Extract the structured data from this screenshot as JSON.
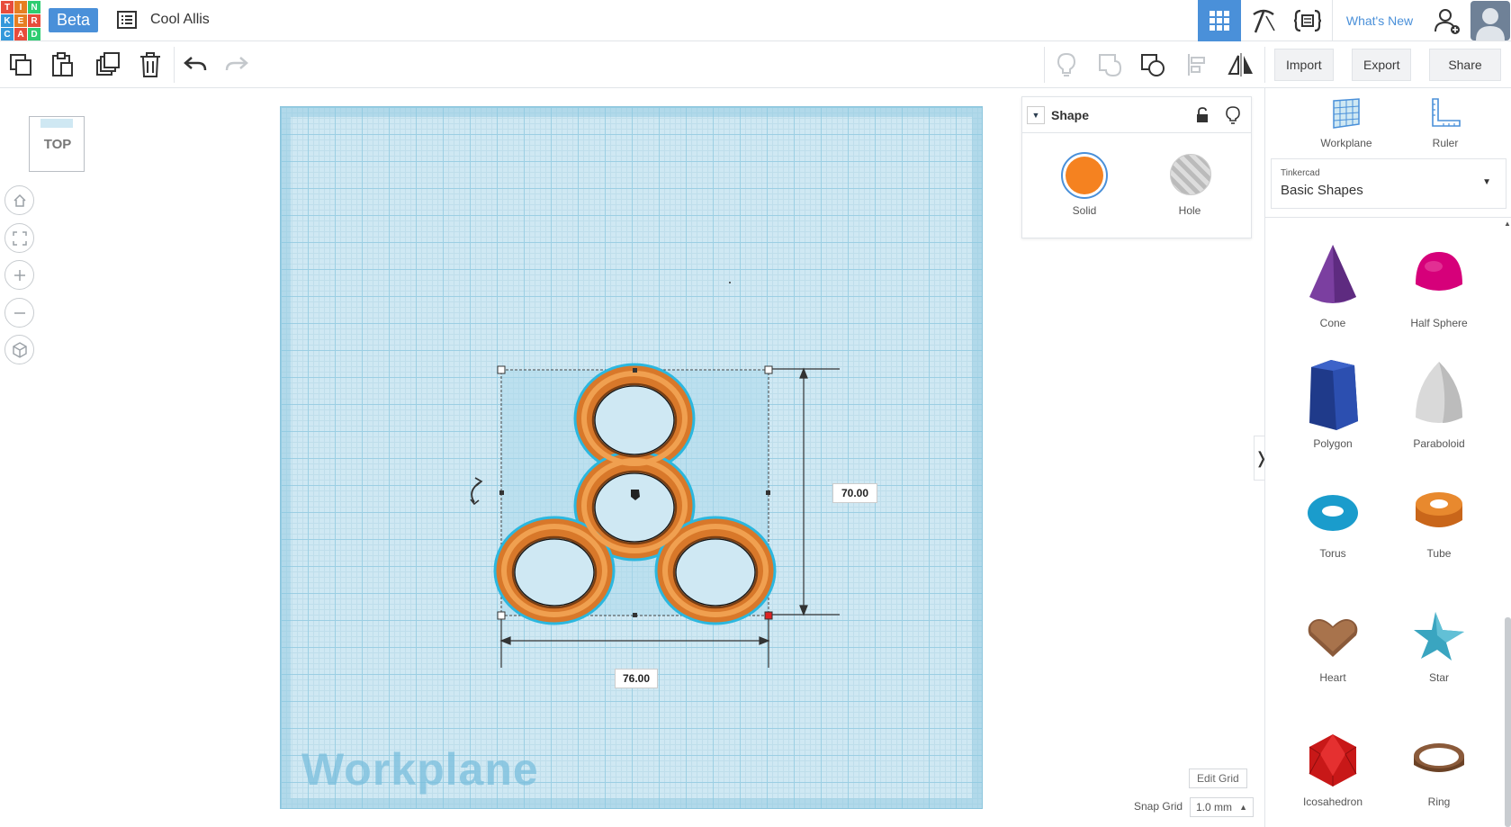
{
  "header": {
    "logo_letters": [
      "T",
      "I",
      "N",
      "K",
      "E",
      "R",
      "C",
      "A",
      "D"
    ],
    "beta_label": "Beta",
    "doc_title": "Cool Allis",
    "whats_new": "What's New"
  },
  "toolbar": {
    "import_label": "Import",
    "export_label": "Export",
    "share_label": "Share"
  },
  "viewcube": {
    "face_label": "TOP"
  },
  "workplane": {
    "watermark": "Workplane",
    "dim_width": "76.00",
    "dim_height": "70.00",
    "edit_grid_label": "Edit Grid",
    "snap_grid_label": "Snap Grid",
    "snap_grid_value": "1.0 mm"
  },
  "shape_panel": {
    "title": "Shape",
    "solid_label": "Solid",
    "hole_label": "Hole",
    "solid_color": "#f58220"
  },
  "right_panel": {
    "workplane_label": "Workplane",
    "ruler_label": "Ruler",
    "library_small": "Tinkercad",
    "library_name": "Basic Shapes",
    "shapes": [
      {
        "label": "Cone",
        "icon": "cone-icon"
      },
      {
        "label": "Half Sphere",
        "icon": "half-sphere-icon"
      },
      {
        "label": "Polygon",
        "icon": "polygon-icon"
      },
      {
        "label": "Paraboloid",
        "icon": "paraboloid-icon"
      },
      {
        "label": "Torus",
        "icon": "torus-icon"
      },
      {
        "label": "Tube",
        "icon": "tube-icon"
      },
      {
        "label": "Heart",
        "icon": "heart-icon"
      },
      {
        "label": "Star",
        "icon": "star-icon"
      },
      {
        "label": "Icosahedron",
        "icon": "icosahedron-icon"
      },
      {
        "label": "Ring",
        "icon": "ring-icon"
      }
    ]
  },
  "colors": {
    "accent": "#4a90d9",
    "orange": "#e8892e",
    "grid": "#cfe8f3"
  }
}
